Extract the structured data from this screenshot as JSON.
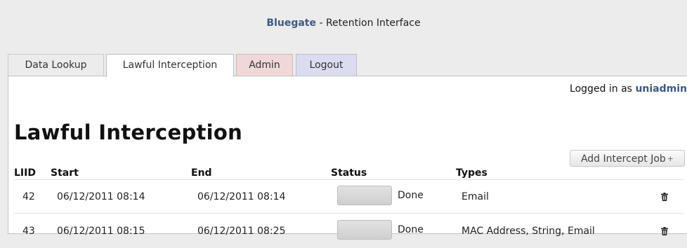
{
  "header": {
    "brand": "Bluegate",
    "subtitle": " - Retention Interface"
  },
  "tabs": [
    {
      "label": "Data Lookup"
    },
    {
      "label": "Lawful Interception",
      "active": true
    },
    {
      "label": "Admin"
    },
    {
      "label": "Logout"
    }
  ],
  "session": {
    "logged_in_label": "Logged in as ",
    "username": "uniadmin"
  },
  "page": {
    "title": "Lawful Interception"
  },
  "toolbar": {
    "add_label": "Add Intercept Job",
    "add_icon": "+"
  },
  "table": {
    "columns": [
      "LIID",
      "Start",
      "End",
      "Status",
      "Types"
    ],
    "rows": [
      {
        "liid": "42",
        "start": "06/12/2011 08:14",
        "end": "06/12/2011 08:14",
        "status": "Done",
        "progress": 1.0,
        "types": "Email"
      },
      {
        "liid": "43",
        "start": "06/12/2011 08:15",
        "end": "06/12/2011 08:25",
        "status": "Done",
        "progress": 1.0,
        "types": "MAC Address, String, Email"
      }
    ]
  },
  "icons": {
    "delete": "trash-icon"
  }
}
